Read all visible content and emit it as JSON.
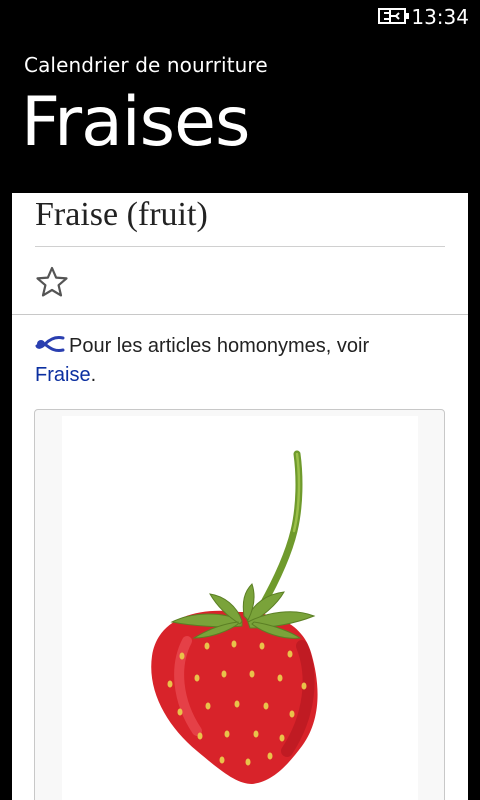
{
  "status": {
    "time": "13:34",
    "battery_icon": "battery-charging-icon"
  },
  "app": {
    "title": "Calendrier de nourriture"
  },
  "page": {
    "title": "Fraises"
  },
  "article": {
    "title": "Fraise (fruit)",
    "watch_icon": "star-outline-icon",
    "hatnote": {
      "icon": "disambiguation-icon",
      "text": "Pour les articles homonymes, voir",
      "link_text": "Fraise",
      "suffix": "."
    },
    "infobox": {
      "image": "strawberry-image"
    }
  },
  "colors": {
    "background": "#000000",
    "link": "#0b2fa0",
    "strawberry_red": "#d8232a",
    "leaf_green": "#6f9a2c"
  }
}
